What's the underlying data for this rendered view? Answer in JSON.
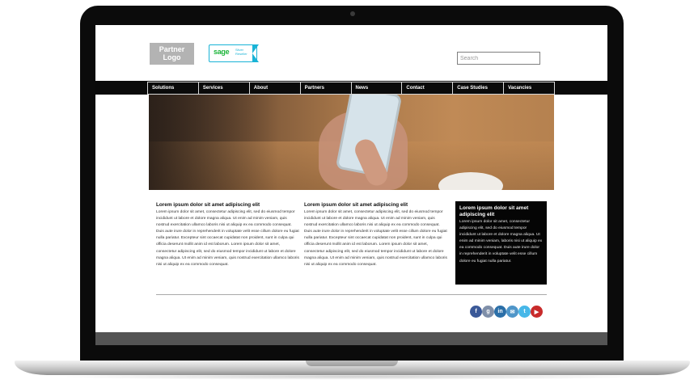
{
  "header": {
    "partner_logo": "Partner Logo",
    "partner_logo_line1": "Partner",
    "partner_logo_line2": "Logo",
    "badge": {
      "brand": "sage",
      "tier": "Silver",
      "level": "Reseller"
    },
    "search": {
      "placeholder": "Search",
      "value": ""
    }
  },
  "nav": {
    "items": [
      "Solutions",
      "Services",
      "About",
      "Partners",
      "News",
      "Contact",
      "Case Studies",
      "Vacancies"
    ]
  },
  "content": {
    "columns": [
      {
        "title": "Lorem ipsum dolor sit amet adipiscing elit",
        "body": "Lorem ipsum dolor sit amet, consectetur adipiscing elit, sed do eiusmod tempor incididunt ut labore et dolore magna aliqua. Ut enim ad minim veniam, quis nostrud exercitation ullamco laboris nisi ut aliquip ex ea commodo consequat. Duis aute irure dolor in reprehenderit in voluptate velit esse cillum dolore eu fugiat nulla pariatur. Excepteur sint occaecat cupidatat non proident, sunt in culpa qui officia deserunt mollit anim id est laborum. Lorem ipsum dolor sit amet, consectetur adipiscing elit, sed do eiusmod tempor incididunt ut labore et dolore magna aliqua. Ut enim ad minim veniam, quis nostrud exercitation ullamco laboris nisi ut aliquip ex ea commodo consequat."
      },
      {
        "title": "Lorem ipsum dolor sit amet adipiscing elit",
        "body": "Lorem ipsum dolor sit amet, consectetur adipiscing elit, sed do eiusmod tempor incididunt ut labore et dolore magna aliqua. Ut enim ad minim veniam, quis nostrud exercitation ullamco laboris nisi ut aliquip ex ea commodo consequat. Duis aute irure dolor in reprehenderit in voluptate velit esse cillum dolore eu fugiat nulla pariatur. Excepteur sint occaecat cupidatat non proident, sunt in culpa qui officia deserunt mollit anim id est laborum. Lorem ipsum dolor sit amet, consectetur adipiscing elit, sed do eiusmod tempor incididunt ut labore et dolore magna aliqua. Ut enim ad minim veniam, quis nostrud exercitation ullamco laboris nisi ut aliquip ex ea commodo consequat."
      }
    ],
    "callout": {
      "title": "Lorem ipsum dolor sit amet adipiscing elit",
      "body": "Lorem ipsum dolor sit amet, consectetur adipiscing elit, sed do eiusmod tempor incididunt ut labore et dolore magna aliqua. Ut enim ad minim veniam, laboris nisi ut aliquip ex ea commodo consequat. Duis aute irure dolor in reprehenderit in voluptate velit esse cillum dolore eu fugiat nulla pariatur."
    }
  },
  "social": {
    "icons": [
      "facebook-icon",
      "google-plus-icon",
      "linkedin-icon",
      "email-icon",
      "twitter-icon",
      "youtube-icon"
    ]
  },
  "colors": {
    "nav_background": "#0a0a0a",
    "callout_background": "#050505",
    "footer_background": "#545454",
    "sage_green": "#1db53a",
    "sage_blue": "#19b3d6"
  }
}
